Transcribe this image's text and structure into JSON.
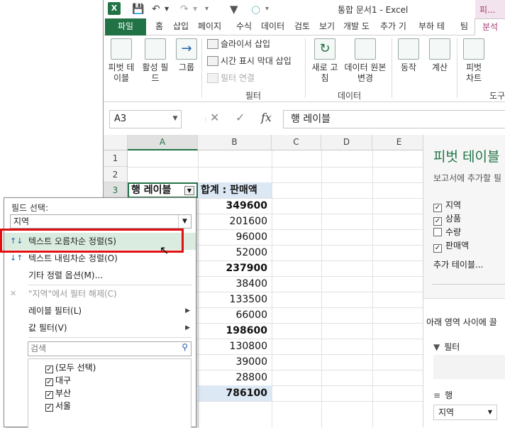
{
  "window": {
    "title": "통합 문서1 - Excel",
    "contextual_tab": "피..."
  },
  "ribbon": {
    "tabs": [
      "파일",
      "홈",
      "삽입",
      "페이지",
      "수식",
      "데이터",
      "검토",
      "보기",
      "개발 도",
      "추가 기",
      "부하 테",
      "팀",
      "분석"
    ],
    "buttons": {
      "pivot_table": "피벗 테\n이블",
      "active_field": "활성 필\n드",
      "group": "그룹",
      "insert_slicer": "슬라이서 삽입",
      "insert_timeline": "시간 표시 막대 삽입",
      "filter_connections": "필터 연결",
      "refresh": "새로 고\n침",
      "change_source": "데이터 원본\n변경",
      "actions": "동작",
      "calculations": "계산",
      "pivot_chart": "피벗\n차트"
    },
    "group_labels": {
      "filter": "필터",
      "data": "데이터",
      "tools": "도구"
    }
  },
  "formula_bar": {
    "name_box": "A3",
    "formula": "행 레이블"
  },
  "grid": {
    "columns": [
      "A",
      "B",
      "C",
      "D",
      "E"
    ],
    "rows": [
      "1",
      "2",
      "3"
    ],
    "header_row": {
      "a": "행 레이블",
      "b": "합계 : 판매액"
    },
    "values": [
      {
        "v": "349600",
        "bold": true
      },
      {
        "v": "201600",
        "bold": false
      },
      {
        "v": "96000",
        "bold": false
      },
      {
        "v": "52000",
        "bold": false
      },
      {
        "v": "237900",
        "bold": true
      },
      {
        "v": "38400",
        "bold": false
      },
      {
        "v": "133500",
        "bold": false
      },
      {
        "v": "66000",
        "bold": false
      },
      {
        "v": "198600",
        "bold": true
      },
      {
        "v": "130800",
        "bold": false
      },
      {
        "v": "39000",
        "bold": false
      },
      {
        "v": "28800",
        "bold": false
      },
      {
        "v": "786100",
        "bold": true
      }
    ]
  },
  "pivot_pane": {
    "title": "피벗 테이블",
    "subtitle": "보고서에 추가할 필",
    "fields": [
      {
        "label": "지역",
        "checked": true
      },
      {
        "label": "상품",
        "checked": true
      },
      {
        "label": "수량",
        "checked": false
      },
      {
        "label": "판매액",
        "checked": true
      }
    ],
    "more_tables": "추가 테이블...",
    "areas_hint": "아래 영역 사이에 끌",
    "filter_area": "필터",
    "rows_area": "행",
    "rows_field": "지역"
  },
  "popup": {
    "field_select_label": "필드 선택:",
    "field_select_value": "지역",
    "sort_asc": "텍스트 오름차순 정렬(S)",
    "sort_desc": "텍스트 내림차순 정렬(O)",
    "more_sort": "기타 정렬 옵션(M)...",
    "clear_filter": "\"지역\"에서 필터 해제(C)",
    "label_filter": "레이블 필터(L)",
    "value_filter": "값 필터(V)",
    "search_placeholder": "검색",
    "tree": [
      {
        "label": "(모두 선택)",
        "checked": true
      },
      {
        "label": "대구",
        "checked": true
      },
      {
        "label": "부산",
        "checked": true
      },
      {
        "label": "서울",
        "checked": true
      }
    ]
  },
  "colors": {
    "excel_green": "#217346",
    "highlight_red": "#e01010",
    "pivot_magenta": "#a3386f",
    "total_row_bg": "#dde8f5"
  }
}
